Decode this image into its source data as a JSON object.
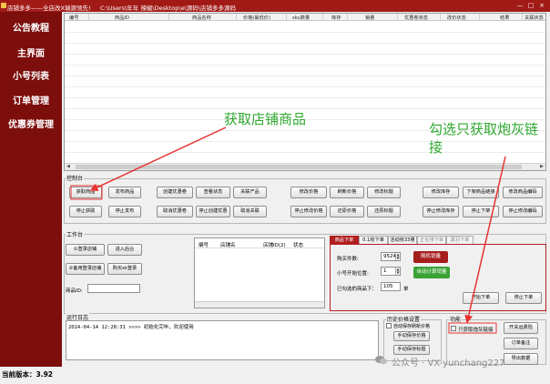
{
  "titlebar": {
    "app": "店铺多多——全店改X瑞源领先!",
    "path": "C:\\Users\\年年 辣椒\\Desktop\\e\\源码\\店铺多多源码",
    "min": "—",
    "max": "□",
    "close": "×"
  },
  "sidebar": {
    "items": [
      "公告教程",
      "主界面",
      "小号列表",
      "订单管理",
      "优惠券管理"
    ]
  },
  "version": "当前版本：3.92",
  "grid": {
    "columns": [
      "编号",
      "商品ID",
      "商品名称",
      "价格(最低价)",
      "sku数量",
      "库存",
      "销量",
      "优惠卷状态",
      "改价状态",
      "结果",
      "关联状态"
    ],
    "scroll_left": "◀",
    "scroll_right": "▶"
  },
  "control": {
    "title": "控制台",
    "buttons_row1": [
      "获取商品",
      "发布商品",
      "创建优惠卷",
      "查看状态",
      "关联产品",
      "修改价格",
      "刷新价格",
      "修改标题",
      "修改库存",
      "下架商品链接",
      "修改商品编码"
    ],
    "buttons_row2": [
      "停止获取",
      "停止发布",
      "取消优惠卷",
      "停止创建优惠",
      "取消关联",
      "停止修改价格",
      "还原价格",
      "还原标题",
      "停止修改库存",
      "停止下架",
      "停止修改编码"
    ]
  },
  "workbench": {
    "title": "工作台",
    "btn_login_shop": "①登录店铺",
    "btn_enter_backend": "进入后台",
    "btn_backup_login": "②备用登录店铺",
    "btn_cat_login": "购买sk登录",
    "product_id_label": "商品ID:",
    "product_id_value": ""
  },
  "accounts": {
    "columns": [
      "编号",
      "店铺名",
      "店铺ID(2)",
      "状态"
    ]
  },
  "order_tabs": {
    "tabs": [
      "商品下单",
      "0.1抢下单",
      "活动抢33量",
      "正在排下单",
      "黑羽下单"
    ],
    "buy_count_label": "购买件数:",
    "buy_count_value": "9524",
    "random_btn": "随机销量",
    "start_pos_label": "小号开始位置:",
    "start_pos_value": "1",
    "auto_calc_btn": "自动计算销量",
    "plan_label": "已勾选的商品下：",
    "plan_value": "105",
    "plan_unit": "单",
    "start_btn": "开始下单",
    "stop_btn": "停止下单"
  },
  "log": {
    "title": "运行日志",
    "line": "2024-04-14 12:28:31 >>>> 初始化完毕，欢迎使用"
  },
  "price_history": {
    "title": "历史价格设置",
    "checkbox_label": "自动保存刷新价格",
    "btn_save": "手动保存价格",
    "btn_restore": "手动保存标题"
  },
  "features": {
    "title": "功能",
    "checkbox_label": "只获取炮灰链接",
    "btn_close_app": "开关运费险",
    "btn_order_note": "订单备注",
    "btn_export": "导出数据"
  },
  "annotations": {
    "get_products": "获取店铺商品",
    "check_only": "勾选只获取炮灰链接"
  },
  "watermark": "公众号 · VX-yunchang227",
  "colors": {
    "title_red": "#a21a16",
    "sidebar_red": "#7c0e0c",
    "annotation_green": "#2fa82f",
    "arrow_red": "#e8322f"
  }
}
